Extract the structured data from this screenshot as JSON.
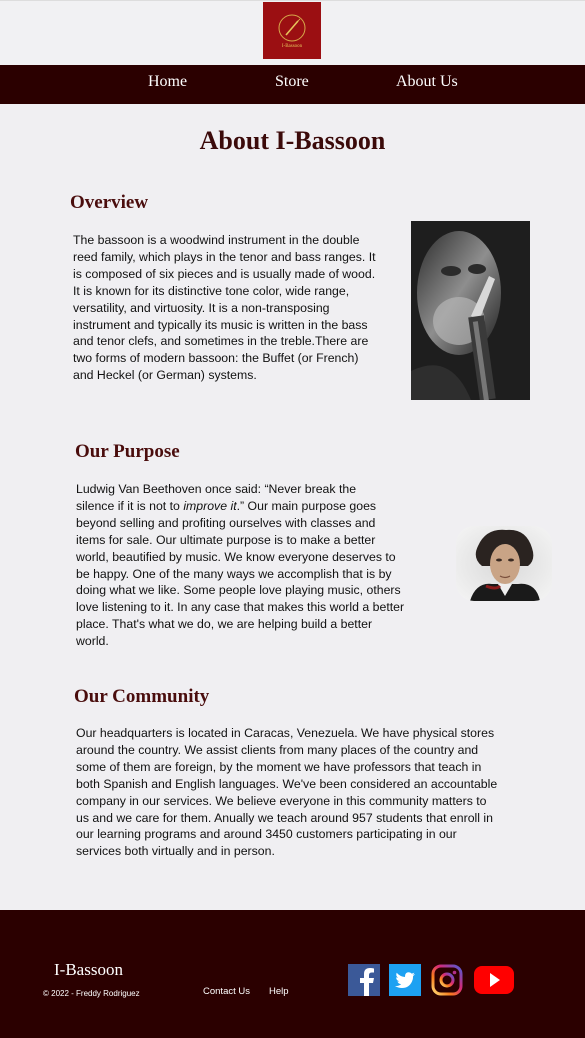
{
  "logo": {
    "text": "I-Bassoon"
  },
  "nav": {
    "home": "Home",
    "store": "Store",
    "about": "About Us"
  },
  "page": {
    "title": "About I-Bassoon"
  },
  "overview": {
    "title": "Overview",
    "lines": [
      "The bassoon is a woodwind instrument in the double",
      "reed family, which plays in the tenor and bass ranges. It",
      "is composed of six pieces and is usually made of wood.",
      "It is known for its distinctive tone color, wide range,",
      "versatility, and virtuosity. It is a non-transposing",
      "instrument and typically its music is written in the bass",
      "and tenor clefs, and sometimes in the treble.There are",
      "two forms of modern bassoon: the Buffet (or French)",
      "and Heckel (or German) systems."
    ]
  },
  "purpose": {
    "title": "Our Purpose",
    "line1": "Ludwig Van Beethoven once said: “Never break the",
    "line2_pre": "silence if it is not to ",
    "line2_italic": "improve it",
    "line2_post": ".” Our main purpose goes",
    "lines_rest": [
      "beyond selling and profiting ourselves with classes and",
      "items for sale. Our ultimate purpose is to make a better",
      "world, beautified by music. We know everyone deserves to",
      "be happy. One of the many ways we accomplish that is by",
      "doing what we like. Some people love playing music, others",
      "love listening to it. In any case that makes this world a better",
      "place. That's what we do, we are helping build a better",
      "world."
    ]
  },
  "community": {
    "title": "Our Community",
    "lines": [
      "Our headquarters is located in Caracas, Venezuela. We have physical stores",
      "around the country. We assist clients from many places of the country and",
      "some of them are foreign, by the moment we have professors that teach in",
      "both Spanish and English languages. We've been considered an accountable",
      "company in our services. We believe everyone in this community matters to",
      "us and we care for them. Anually we teach around 957 students that enroll in",
      "our learning programs and around 3450 customers participating in our",
      "services both virtually and in person."
    ]
  },
  "footer": {
    "brand": "I-Bassoon",
    "copyright": "© 2022 - Freddy Rodriguez",
    "contact": "Contact Us",
    "help": "Help",
    "social": [
      "facebook-icon",
      "twitter-icon",
      "instagram-icon",
      "youtube-icon"
    ]
  },
  "colors": {
    "brand_dark": "#2b0000",
    "logo_red": "#9b0f12",
    "heading": "#4a0d0d",
    "background": "#f0eff2"
  }
}
